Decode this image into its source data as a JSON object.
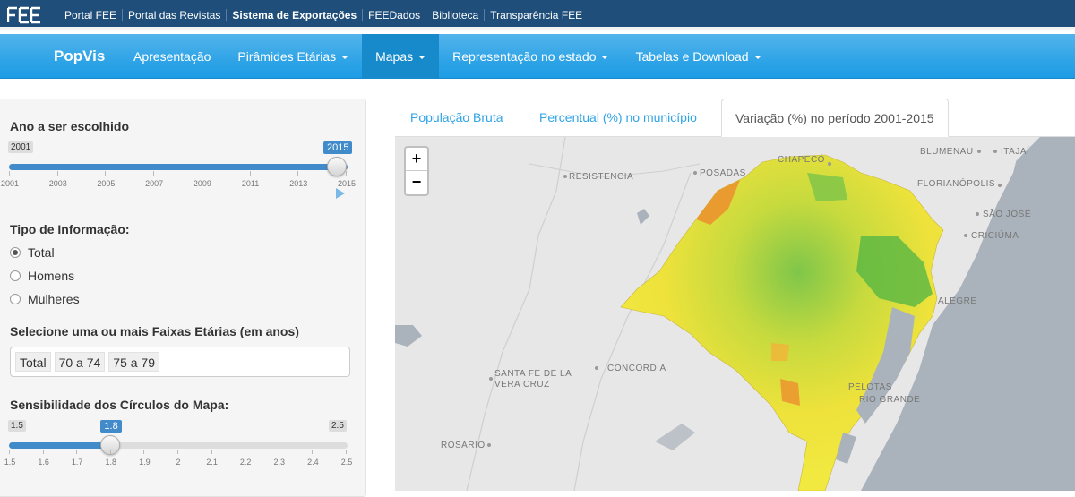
{
  "topbar": {
    "logo_text": "FEE",
    "links": [
      "Portal FEE",
      "Portal das Revistas",
      "Sistema de Exportações",
      "FEEDados",
      "Biblioteca",
      "Transparência FEE"
    ]
  },
  "navbar": {
    "brand": "PopVis",
    "items": [
      "Apresentação",
      "Pirâmides Etárias",
      "Mapas",
      "Representação no estado",
      "Tabelas e Download"
    ],
    "active_item": "Mapas"
  },
  "sidebar": {
    "year_label": "Ano a ser escolhido",
    "year_slider": {
      "min": "2001",
      "max": "2015",
      "value": "2015",
      "value_fraction": 1.0,
      "ticks": [
        "2001",
        "2003",
        "2005",
        "2007",
        "2009",
        "2011",
        "2013",
        "2015"
      ]
    },
    "info_label": "Tipo de Informação:",
    "info_options": [
      "Total",
      "Homens",
      "Mulheres"
    ],
    "info_selected": "Total",
    "age_label": "Selecione uma ou mais Faixas Etárias (em anos)",
    "age_chips": [
      "Total",
      "70 a 74",
      "75 a 79"
    ],
    "sens_label": "Sensibilidade dos Círculos do Mapa:",
    "sens_slider": {
      "min": "1.5",
      "max": "2.5",
      "value": "1.8",
      "value_fraction": 0.3,
      "ticks": [
        "1.5",
        "1.6",
        "1.7",
        "1.8",
        "1.9",
        "2",
        "2.1",
        "2.2",
        "2.3",
        "2.4",
        "2.5"
      ]
    }
  },
  "tabs": {
    "items": [
      "População Bruta",
      "Percentual (%) no município",
      "Variação (%) no período 2001-2015"
    ],
    "active": "Variação (%) no período 2001-2015"
  },
  "map": {
    "zoom_in": "+",
    "zoom_out": "−",
    "cities": [
      "CHAPECÓ",
      "POSADAS",
      "RESISTENCIA",
      "BLUMENAU",
      "ITAJAÍ",
      "FLORIANÓPOLIS",
      "SÃO JOSÉ",
      "CRICIÚMA",
      "ALEGRE",
      "SANTA FE DE LA",
      "VERA CRUZ",
      "CONCORDIA",
      "PELOTAS",
      "RIO GRANDE",
      "ROSARIO"
    ],
    "colors": {
      "land": "#e7e7e7",
      "water": "#aab3bb",
      "low": "#e58a2c",
      "mid": "#f2e23a",
      "high": "#3aae3f"
    }
  }
}
